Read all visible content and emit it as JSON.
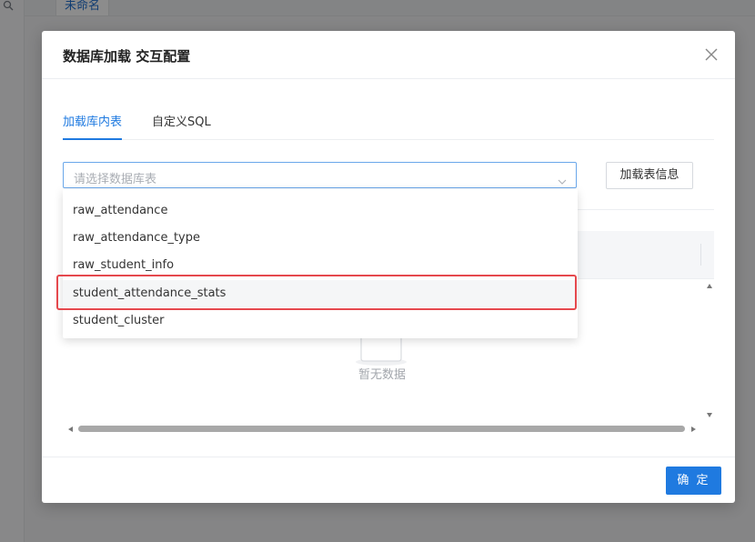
{
  "background": {
    "search_icon": "search-icon",
    "tab_label": "未命名"
  },
  "modal": {
    "title": "数据库加载 交互配置",
    "close_icon": "close-icon",
    "tabs": [
      {
        "label": "加载库内表",
        "active": true
      },
      {
        "label": "自定义SQL",
        "active": false
      }
    ],
    "select": {
      "placeholder": "请选择数据库表",
      "arrow_icon": "chevron-down-icon"
    },
    "load_button": "加载表信息",
    "table": {
      "empty_text": "暂无数据",
      "empty_icon": "empty-box-icon"
    },
    "ok_button": "确 定"
  },
  "dropdown": {
    "items": [
      "raw_attendance",
      "raw_attendance_type",
      "raw_student_info",
      "student_attendance_stats",
      "student_cluster"
    ],
    "hovered_item": "student_attendance_stats"
  },
  "colors": {
    "primary": "#1f7ae0",
    "highlight": "#e5484d"
  }
}
